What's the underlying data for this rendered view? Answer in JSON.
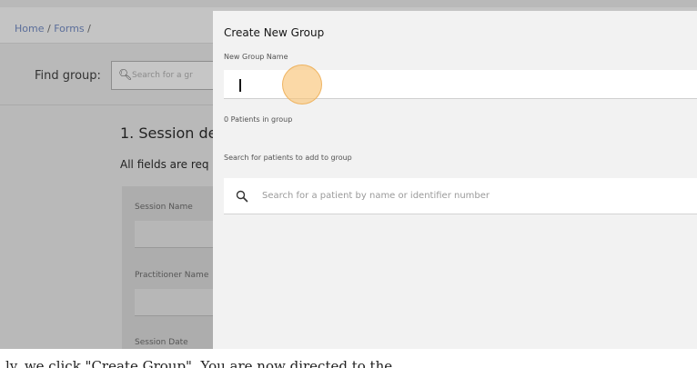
{
  "background": {
    "breadcrumb": {
      "home": "Home",
      "forms": "Forms",
      "separator": "/"
    },
    "find_group_label": "Find group:",
    "search_placeholder": "Search for a gr",
    "section_title": "1. Session de",
    "required_text": "All fields are req",
    "fields": [
      "Session Name",
      "Practitioner Name",
      "Session Date"
    ]
  },
  "modal": {
    "title": "Create New Group",
    "name_label": "New Group Name",
    "name_value": "",
    "patients_count_text": "0 Patients in group",
    "search_label": "Search for patients to add to group",
    "search_placeholder": "Search for a patient by name or identifier number"
  },
  "caption": "ly, we click \"Create Group\". You are now directed to the"
}
